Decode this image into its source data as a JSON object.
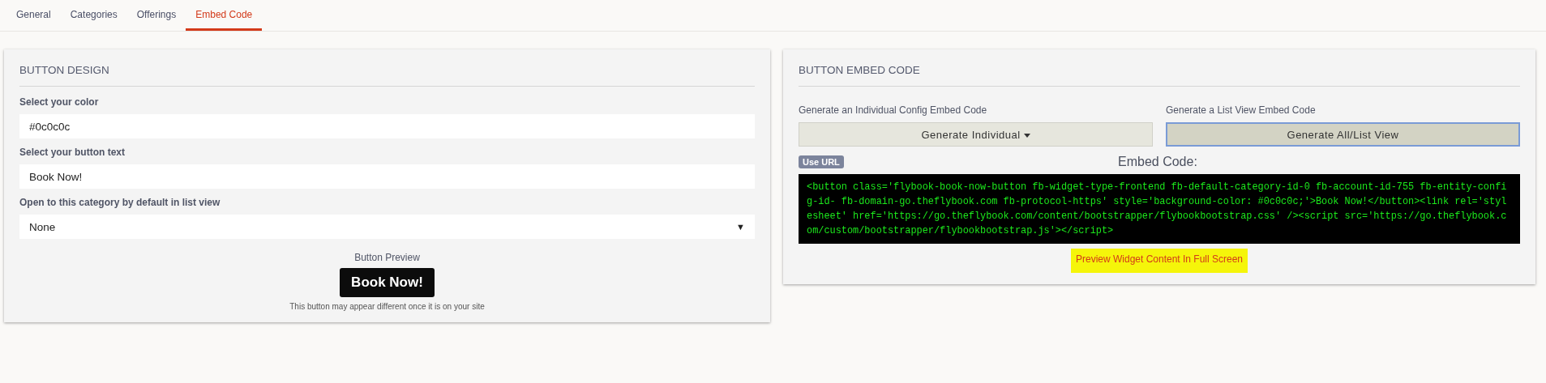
{
  "tabs": [
    {
      "label": "General",
      "selected": false
    },
    {
      "label": "Categories",
      "selected": false
    },
    {
      "label": "Offerings",
      "selected": false
    },
    {
      "label": "Embed Code",
      "selected": true
    }
  ],
  "button_design": {
    "title": "BUTTON DESIGN",
    "color_field": {
      "label": "Select your color",
      "value": "#0c0c0c"
    },
    "text_field": {
      "label": "Select your button text",
      "value": "Book Now!"
    },
    "category_select": {
      "label": "Open to this category by default in list view",
      "value": "None",
      "arrow": "▼"
    },
    "preview": {
      "label": "Button Preview",
      "button": "Book Now!",
      "note": "This button may appear different once it is on your site"
    }
  },
  "embed_code": {
    "title": "BUTTON EMBED CODE",
    "generators": [
      {
        "label": "Generate an Individual Config Embed Code",
        "button": "Generate Individual",
        "dropdown": true,
        "focused": false
      },
      {
        "label": "Generate a List View Embed Code",
        "button": "Generate All/List View",
        "dropdown": false,
        "focused": true
      }
    ],
    "use_url_badge": "Use URL",
    "heading": "Embed Code:",
    "code": "<button class='flybook-book-now-button fb-widget-type-frontend fb-default-category-id-0 fb-account-id-755 fb-entity-config-id- fb-domain-go.theflybook.com fb-protocol-https' style='background-color: #0c0c0c;'>Book Now!</button><link rel='stylesheet' href='https://go.theflybook.com/content/bootstrapper/flybookbootstrap.css' /><script src='https://go.theflybook.com/custom/bootstrapper/flybookbootstrap.js'></script>",
    "preview_link": "Preview Widget Content In Full Screen"
  }
}
